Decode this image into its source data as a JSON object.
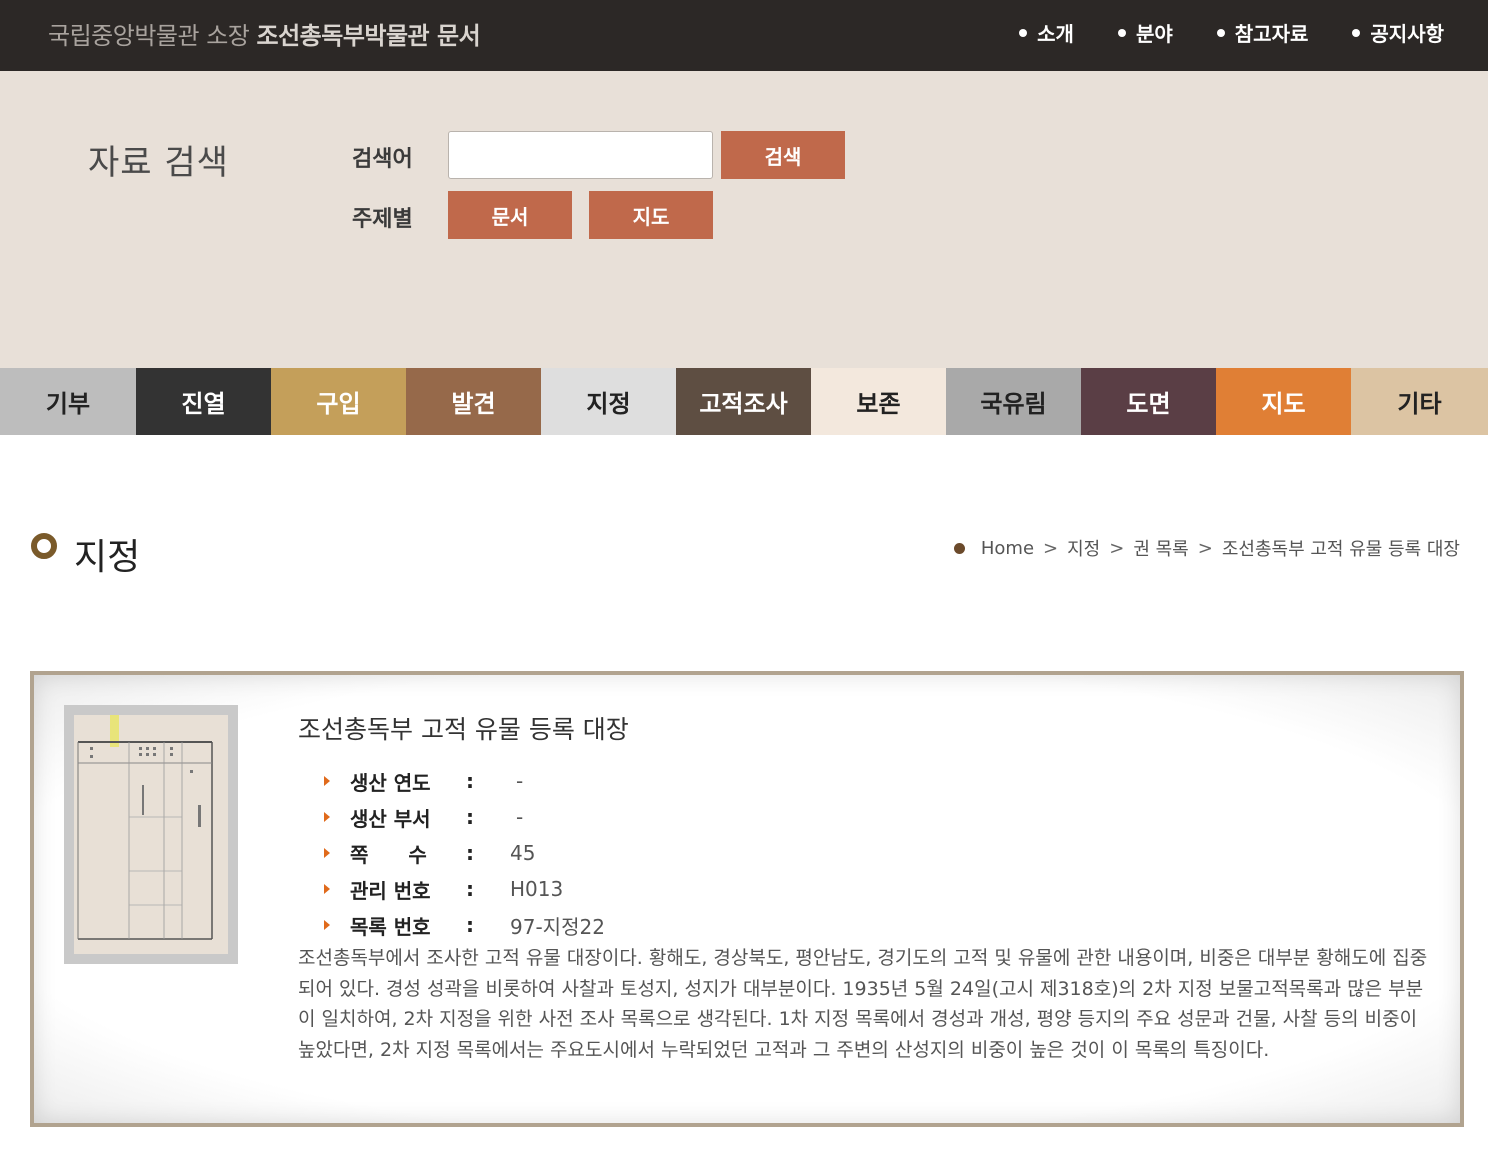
{
  "header": {
    "title_light": "국립중앙박물관 소장",
    "title_bold": "조선총독부박물관 문서",
    "nav": [
      "소개",
      "분야",
      "참고자료",
      "공지사항"
    ]
  },
  "search": {
    "heading": "자료 검색",
    "keyword_label": "검색어",
    "keyword_value": "",
    "search_button": "검색",
    "subject_label": "주제별",
    "subject_buttons": [
      "문서",
      "지도"
    ]
  },
  "categories": [
    {
      "label": "기부",
      "bg": "#bdbdbd",
      "fg": "#222222"
    },
    {
      "label": "진열",
      "bg": "#333333",
      "fg": "#ffffff"
    },
    {
      "label": "구입",
      "bg": "#c49f5a",
      "fg": "#ffffff"
    },
    {
      "label": "발견",
      "bg": "#96694a",
      "fg": "#ffffff"
    },
    {
      "label": "지정",
      "bg": "#dedede",
      "fg": "#222222"
    },
    {
      "label": "고적조사",
      "bg": "#5e4e42",
      "fg": "#ffffff"
    },
    {
      "label": "보존",
      "bg": "#f3e8dd",
      "fg": "#222222"
    },
    {
      "label": "국유림",
      "bg": "#a9a9a9",
      "fg": "#222222"
    },
    {
      "label": "도면",
      "bg": "#5a3e45",
      "fg": "#ffffff"
    },
    {
      "label": "지도",
      "bg": "#e07f35",
      "fg": "#ffffff"
    },
    {
      "label": "기타",
      "bg": "#dcc4a3",
      "fg": "#222222"
    }
  ],
  "page": {
    "title": "지정",
    "breadcrumb": [
      "Home",
      "지정",
      "권 목록",
      "조선총독부 고적 유물 등록 대장"
    ]
  },
  "record": {
    "title": "조선총독부 고적 유물 등록 대장",
    "fields": [
      {
        "label": "생산 연도",
        "colon": ":",
        "value": "-"
      },
      {
        "label": "생산 부서",
        "colon": ":",
        "value": "-"
      },
      {
        "label": "쪽　　수",
        "colon": ":",
        "value": "45"
      },
      {
        "label": "관리 번호",
        "colon": ":",
        "value": "H013"
      },
      {
        "label": "목록 번호",
        "colon": ":",
        "value": "97-지정22"
      }
    ],
    "description": "조선총독부에서 조사한 고적 유물 대장이다. 황해도, 경상북도, 평안남도, 경기도의 고적 및 유물에 관한 내용이며, 비중은 대부분 황해도에 집중되어 있다. 경성 성곽을 비롯하여 사찰과 토성지, 성지가 대부분이다. 1935년 5월 24일(고시 제318호)의 2차 지정 보물고적목록과 많은 부분이 일치하여, 2차 지정을 위한 사전 조사 목록으로 생각된다. 1차 지정 목록에서 경성과 개성, 평양 등지의 주요 성문과 건물, 사찰 등의 비중이 높았다면, 2차 지정 목록에서는 주요도시에서 누락되었던 고적과 그 주변의 산성지의 비중이 높은 것이 이 목록의 특징이다."
  }
}
